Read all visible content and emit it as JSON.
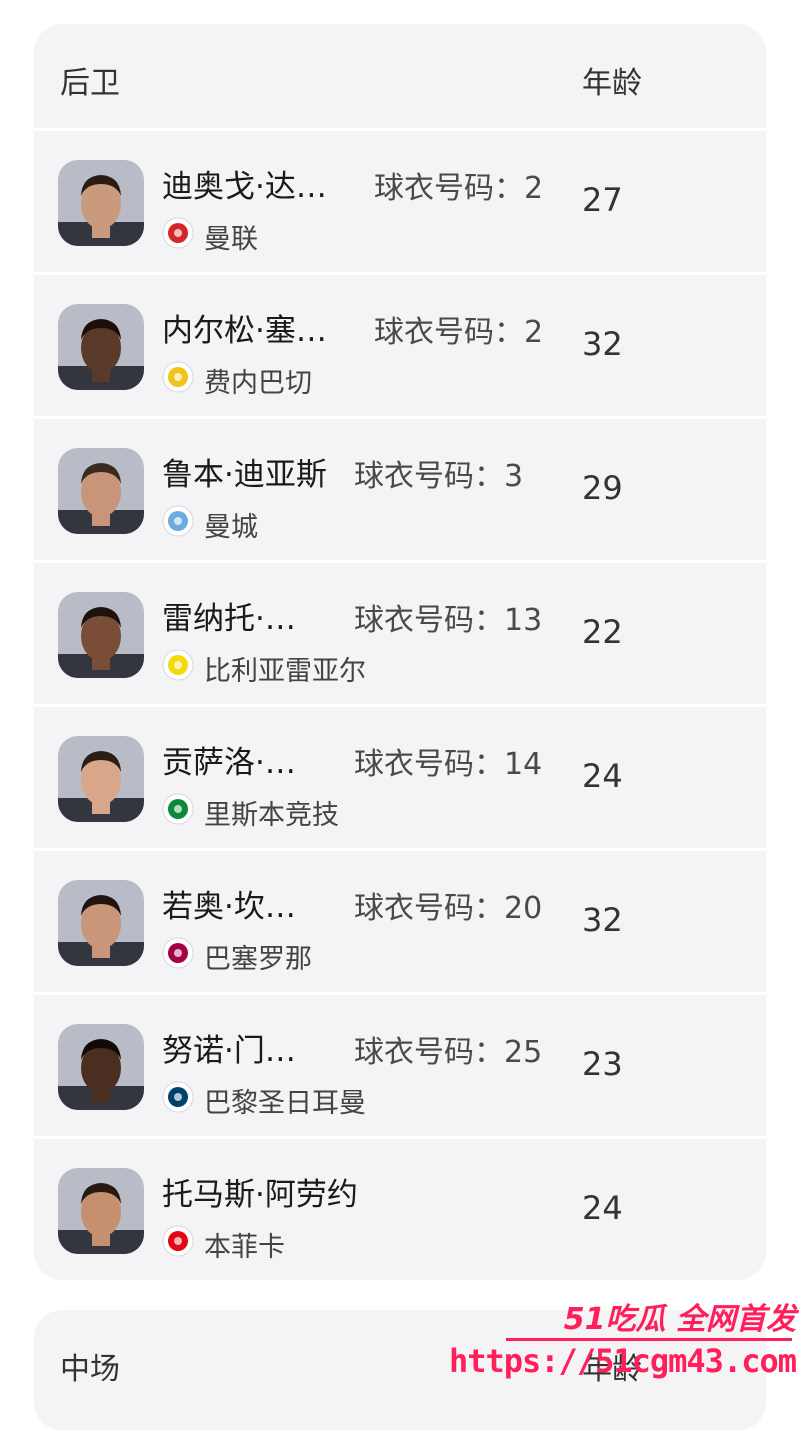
{
  "defenders": {
    "title": "后卫",
    "age_header": "年龄",
    "players": [
      {
        "name": "迪奥戈·达…",
        "jersey": "球衣号码：2",
        "club": "曼联",
        "age": "27",
        "club_badge": "man-utd",
        "badge_color": "#d62728",
        "skin": "#c99a7c",
        "hair": "#2a1c14"
      },
      {
        "name": "内尔松·塞…",
        "jersey": "球衣号码：2",
        "club": "费内巴切",
        "age": "32",
        "club_badge": "fenerbahce",
        "badge_color": "#f0c419",
        "skin": "#5a3a28",
        "hair": "#1a1008"
      },
      {
        "name": "鲁本·迪亚斯",
        "jersey": "球衣号码：3",
        "club": "曼城",
        "age": "29",
        "club_badge": "man-city",
        "badge_color": "#6cabdd",
        "skin": "#c8957a",
        "hair": "#3a2a20"
      },
      {
        "name": "雷纳托·…",
        "jersey": "球衣号码：13",
        "club": "比利亚雷亚尔",
        "age": "22",
        "club_badge": "villarreal",
        "badge_color": "#f5d90a",
        "skin": "#7a4e36",
        "hair": "#1d120c"
      },
      {
        "name": "贡萨洛·…",
        "jersey": "球衣号码：14",
        "club": "里斯本竞技",
        "age": "24",
        "club_badge": "sporting",
        "badge_color": "#0a8a3a",
        "skin": "#d8a689",
        "hair": "#2b1d16"
      },
      {
        "name": "若奥·坎…",
        "jersey": "球衣号码：20",
        "club": "巴塞罗那",
        "age": "32",
        "club_badge": "barcelona",
        "badge_color": "#a50044",
        "skin": "#c9967a",
        "hair": "#1e1510"
      },
      {
        "name": "努诺·门…",
        "jersey": "球衣号码：25",
        "club": "巴黎圣日耳曼",
        "age": "23",
        "club_badge": "psg",
        "badge_color": "#004170",
        "skin": "#4a2e20",
        "hair": "#120a06"
      },
      {
        "name": "托马斯·阿劳约",
        "jersey": "",
        "club": "本菲卡",
        "age": "24",
        "club_badge": "benfica",
        "badge_color": "#e30613",
        "skin": "#c68f6f",
        "hair": "#261a12"
      }
    ]
  },
  "midfield": {
    "title": "中场",
    "age_header": "年龄"
  },
  "watermark": {
    "line1": "51吃瓜 全网首发",
    "line2": "https://51cgm43.com"
  }
}
